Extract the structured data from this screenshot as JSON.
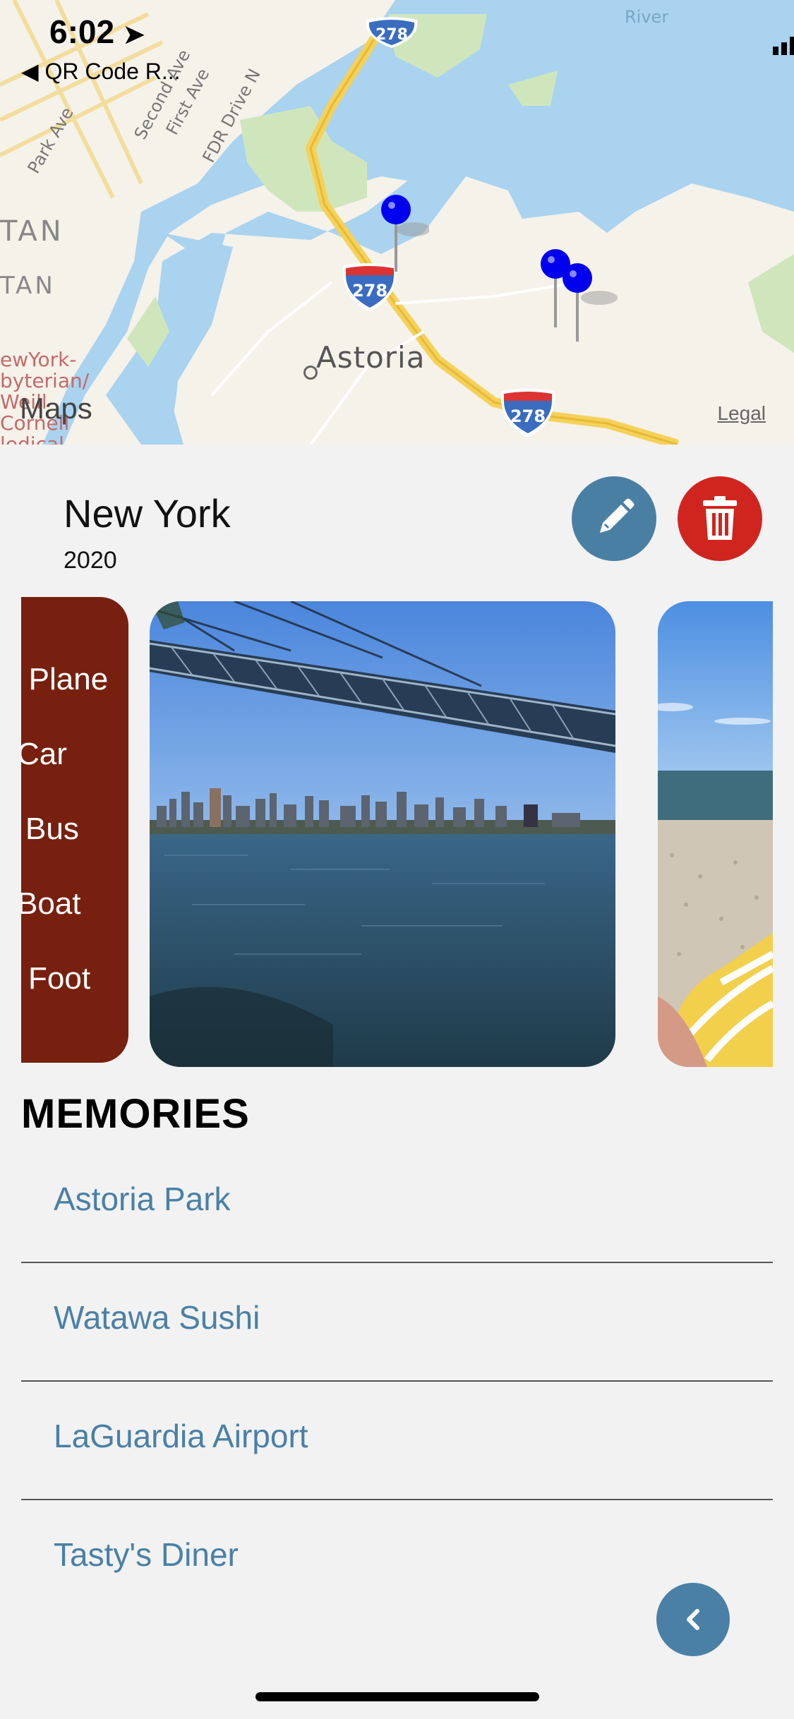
{
  "status_bar": {
    "time": "6:02",
    "back_app": "QR Code R..."
  },
  "map": {
    "labels": {
      "park_ave": "Park Ave",
      "second_ave": "Second Ave",
      "first_ave": "First Ave",
      "fdr_drive": "FDR Drive N",
      "tan1": "TAN",
      "tan2": "TAN",
      "hospital": "ewYork-\nbyterian/\nWeill\nCornell\nledical",
      "river": "River",
      "astoria": "Astoria"
    },
    "shields": [
      "278",
      "278",
      "278"
    ],
    "attribution": "Maps",
    "legal": "Legal"
  },
  "place": {
    "title": "New York",
    "year": "2020"
  },
  "actions": {
    "edit_icon": "pencil-icon",
    "delete_icon": "trash-icon"
  },
  "transport": [
    "Plane",
    "Car",
    "Bus",
    "Boat",
    "Foot"
  ],
  "memories": {
    "title": "MEMORIES",
    "items": [
      "Astoria Park",
      "Watawa Sushi",
      "LaGuardia Airport",
      "Tasty's Diner"
    ]
  },
  "colors": {
    "accent": "#4a80a6",
    "delete": "#d0251f",
    "transport_card": "#77200f",
    "pin": "#0000ee"
  }
}
